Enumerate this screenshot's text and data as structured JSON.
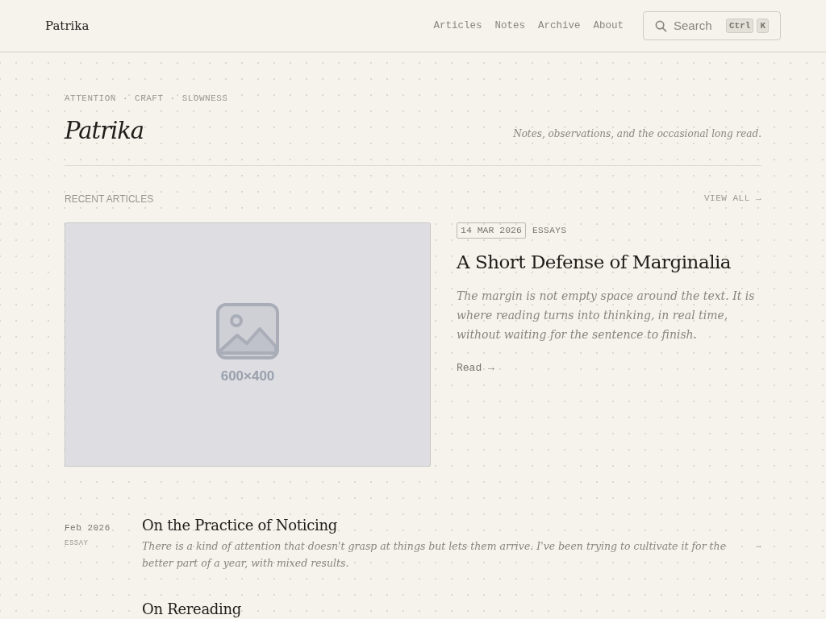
{
  "header": {
    "brand": "Patrika",
    "nav": [
      {
        "label": "Articles"
      },
      {
        "label": "Notes"
      },
      {
        "label": "Archive"
      },
      {
        "label": "About"
      }
    ],
    "search": {
      "placeholder": "Search",
      "keys": [
        "Ctrl",
        "K"
      ]
    }
  },
  "hero": {
    "tags": [
      "ATTENTION",
      "CRAFT",
      "SLOWNESS"
    ],
    "separator": "·",
    "title": "Patrika",
    "tagline": "Notes, observations, and the occasional long read."
  },
  "recent": {
    "heading": "RECENT ARTICLES",
    "view_all": "VIEW ALL →"
  },
  "featured": {
    "image": {
      "kind": "placeholder",
      "label": "600×400"
    },
    "date": "14 MAR 2026",
    "category": "ESSAYS",
    "title": "A Short Defense of Marginalia",
    "excerpt": "The margin is not empty space around the text. It is where reading turns into thinking, in real time, without waiting for the sentence to finish.",
    "link": "Read →"
  },
  "articles": [
    {
      "date": "Feb 2026",
      "category": "ESSAY",
      "title": "On the Practice of Noticing",
      "excerpt": "There is a kind of attention that doesn't grasp at things but lets them arrive. I've been trying to cultivate it for the better part of a year, with mixed results.",
      "arrow": "→"
    },
    {
      "title": "On Rereading"
    }
  ]
}
